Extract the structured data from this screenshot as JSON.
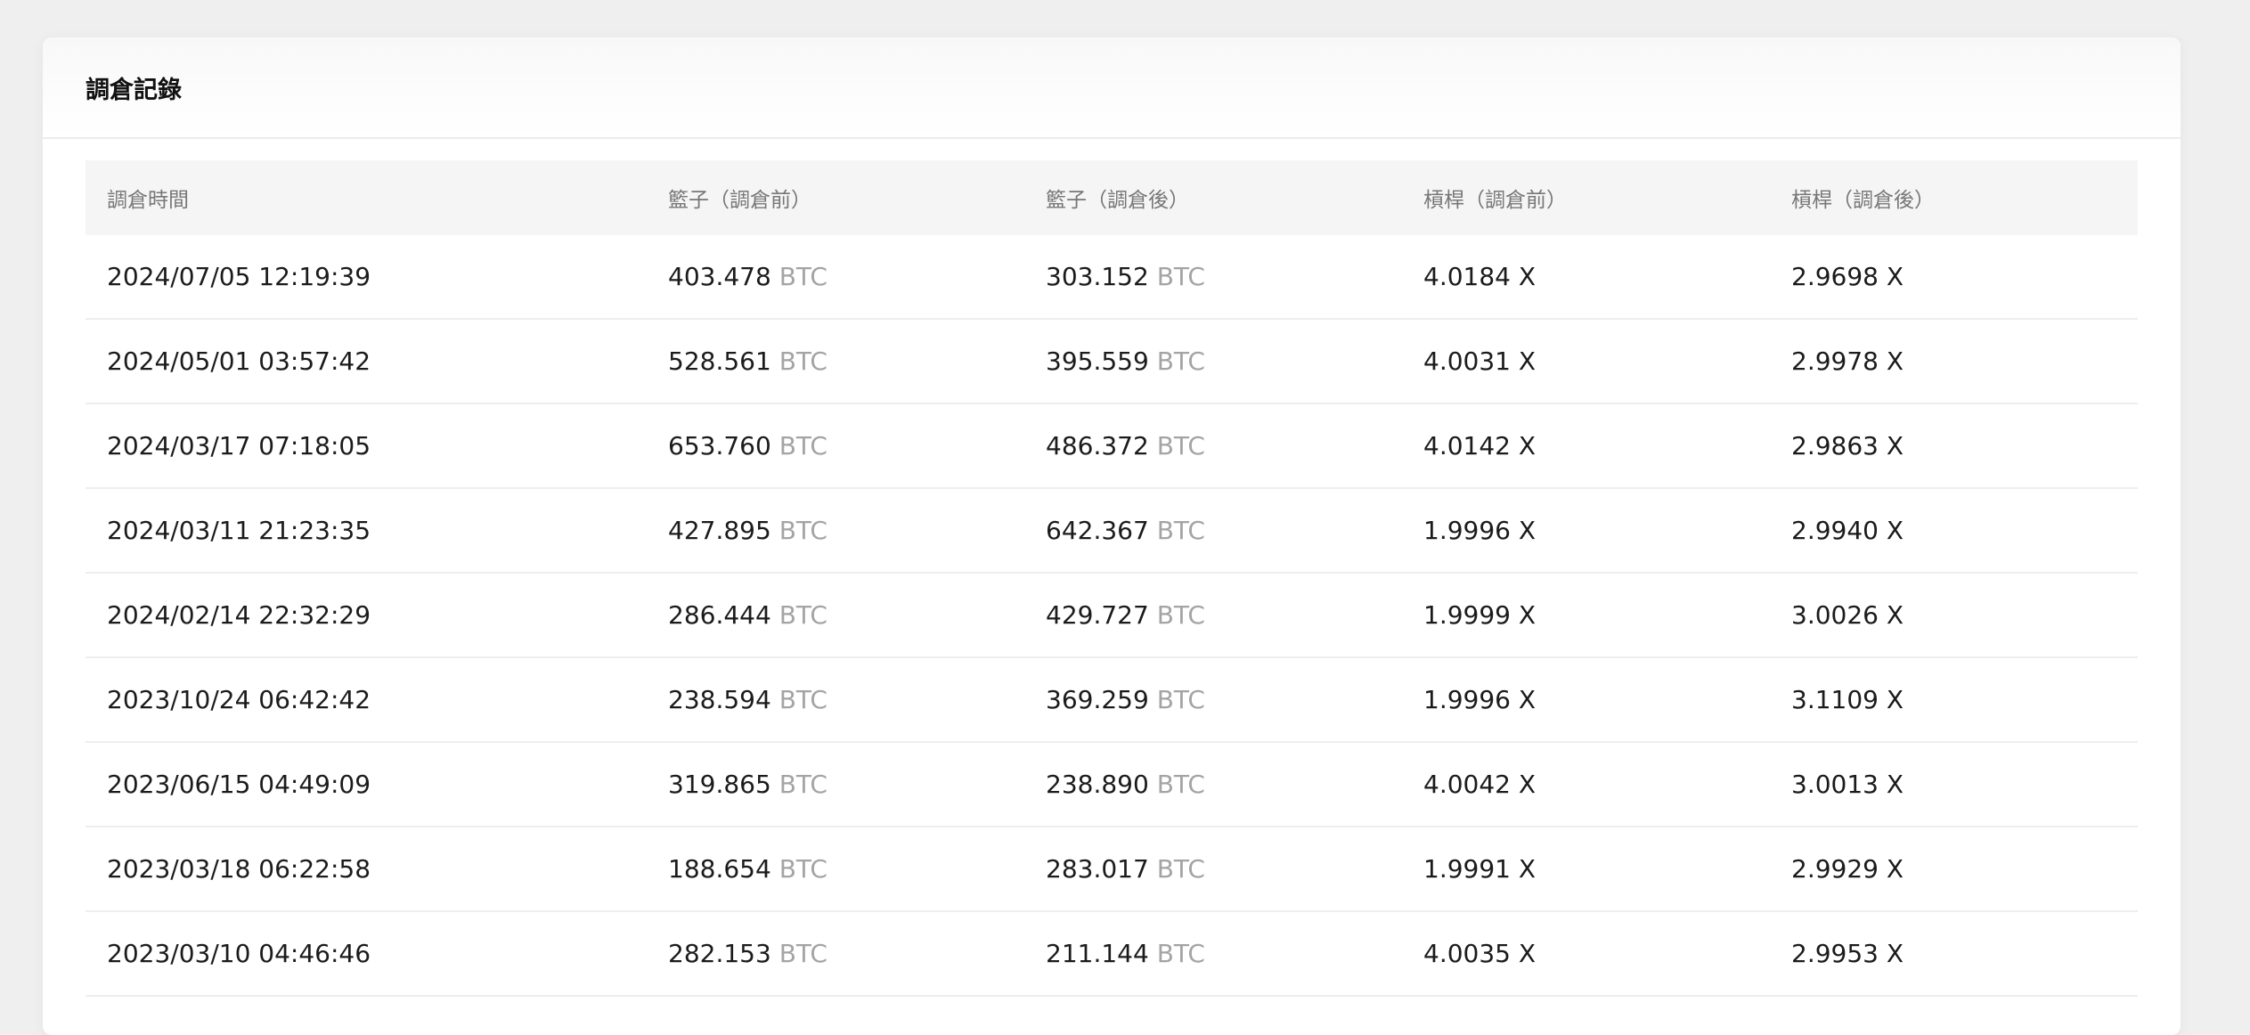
{
  "card": {
    "title": "調倉記錄"
  },
  "table": {
    "headers": [
      "調倉時間",
      "籃子（調倉前）",
      "籃子（調倉後）",
      "槓桿（調倉前）",
      "槓桿（調倉後）"
    ],
    "btc_unit": "BTC",
    "x_unit": "X",
    "rows": [
      {
        "time": "2024/07/05 12:19:39",
        "basket_before": "403.478",
        "basket_after": "303.152",
        "lev_before": "4.0184",
        "lev_after": "2.9698"
      },
      {
        "time": "2024/05/01 03:57:42",
        "basket_before": "528.561",
        "basket_after": "395.559",
        "lev_before": "4.0031",
        "lev_after": "2.9978"
      },
      {
        "time": "2024/03/17 07:18:05",
        "basket_before": "653.760",
        "basket_after": "486.372",
        "lev_before": "4.0142",
        "lev_after": "2.9863"
      },
      {
        "time": "2024/03/11 21:23:35",
        "basket_before": "427.895",
        "basket_after": "642.367",
        "lev_before": "1.9996",
        "lev_after": "2.9940"
      },
      {
        "time": "2024/02/14 22:32:29",
        "basket_before": "286.444",
        "basket_after": "429.727",
        "lev_before": "1.9999",
        "lev_after": "3.0026"
      },
      {
        "time": "2023/10/24 06:42:42",
        "basket_before": "238.594",
        "basket_after": "369.259",
        "lev_before": "1.9996",
        "lev_after": "3.1109"
      },
      {
        "time": "2023/06/15 04:49:09",
        "basket_before": "319.865",
        "basket_after": "238.890",
        "lev_before": "4.0042",
        "lev_after": "3.0013"
      },
      {
        "time": "2023/03/18 06:22:58",
        "basket_before": "188.654",
        "basket_after": "283.017",
        "lev_before": "1.9991",
        "lev_after": "2.9929"
      },
      {
        "time": "2023/03/10 04:46:46",
        "basket_before": "282.153",
        "basket_after": "211.144",
        "lev_before": "4.0035",
        "lev_after": "2.9953"
      }
    ]
  }
}
